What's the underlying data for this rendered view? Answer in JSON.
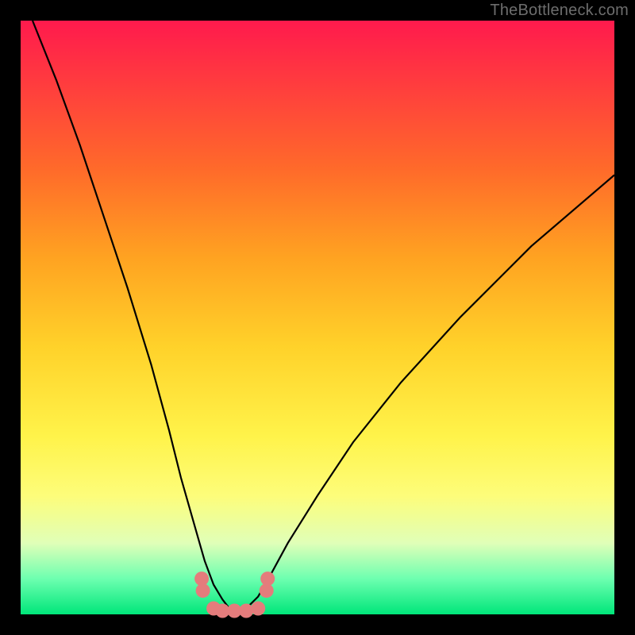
{
  "watermark": "TheBottleneck.com",
  "chart_data": {
    "type": "line",
    "title": "",
    "xlabel": "",
    "ylabel": "",
    "xlim": [
      0,
      100
    ],
    "ylim": [
      0,
      100
    ],
    "grid": false,
    "legend": false,
    "series": [
      {
        "name": "left-curve",
        "x": [
          2,
          6,
          10,
          14,
          18,
          22,
          25,
          27,
          29,
          31,
          32.5,
          34,
          35,
          36,
          37
        ],
        "y": [
          100,
          90,
          79,
          67,
          55,
          42,
          31,
          23,
          16,
          9,
          5,
          2.5,
          1.2,
          0.6,
          0.4
        ]
      },
      {
        "name": "right-curve",
        "x": [
          37,
          38,
          40,
          42,
          45,
          50,
          56,
          64,
          74,
          86,
          100
        ],
        "y": [
          0.4,
          1.0,
          3,
          6.5,
          12,
          20,
          29,
          39,
          50,
          62,
          74
        ]
      },
      {
        "name": "bottom-markers",
        "x": [
          30.5,
          30.7,
          32.5,
          34.0,
          36.0,
          38.0,
          40.0,
          41.4,
          41.6
        ],
        "y": [
          6.0,
          4.0,
          1.0,
          0.6,
          0.6,
          0.6,
          1.0,
          4.0,
          6.0
        ]
      }
    ],
    "colors": {
      "curve": "#000000",
      "marker": "#e47c7c"
    },
    "gradient_stops": [
      {
        "pos": 0,
        "color": "#ff1a4d"
      },
      {
        "pos": 10,
        "color": "#ff3a3f"
      },
      {
        "pos": 25,
        "color": "#ff6a2a"
      },
      {
        "pos": 40,
        "color": "#ffa321"
      },
      {
        "pos": 55,
        "color": "#ffd22a"
      },
      {
        "pos": 70,
        "color": "#fff34a"
      },
      {
        "pos": 80,
        "color": "#fdfd7a"
      },
      {
        "pos": 88,
        "color": "#e0ffb8"
      },
      {
        "pos": 94,
        "color": "#6dffb0"
      },
      {
        "pos": 100,
        "color": "#00e67a"
      }
    ]
  }
}
